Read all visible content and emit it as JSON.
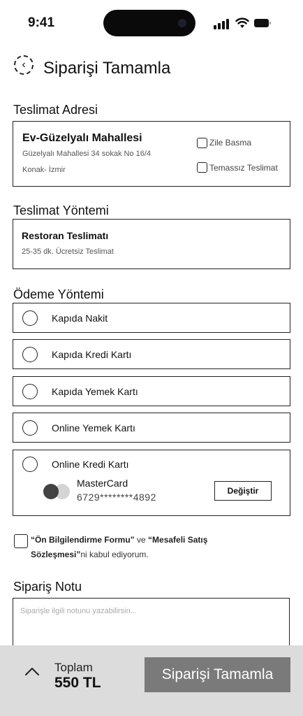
{
  "status_bar": {
    "time": "9:41"
  },
  "header": {
    "title": "Siparişi Tamamla"
  },
  "address": {
    "section_title": "Teslimat Adresi",
    "name": "Ev-Güzelyalı Mahallesi",
    "line1": "Güzelyalı Mahallesi 34 sokak No 16/4",
    "line2": "Konak- İzmir",
    "options": [
      {
        "label": "Zile Basma",
        "checked": false
      },
      {
        "label": "Temassız Teslimat",
        "checked": false
      }
    ]
  },
  "delivery": {
    "section_title": "Teslimat Yöntemi",
    "name": "Restoran Teslimatı",
    "info": "25-35 dk. Ücretsiz Teslimat"
  },
  "payment": {
    "section_title": "Ödeme Yöntemi",
    "methods": [
      {
        "label": "Kapıda Nakit"
      },
      {
        "label": "Kapıda Kredi Kartı"
      },
      {
        "label": "Kapıda Yemek Kartı"
      },
      {
        "label": "Online Yemek Kartı"
      },
      {
        "label": "Online Kredi Kartı"
      }
    ],
    "card": {
      "brand": "MasterCard",
      "number": "6729********4892",
      "change_label": "Değiştir",
      "colors": {
        "left": "#333333",
        "right": "#d4d4d4"
      }
    }
  },
  "agreement": {
    "link1": "“Ön Bilgilendirme Formu”",
    "connector": " ve ",
    "link2": "“Mesafeli Satış Sözleşmesi”",
    "suffix": "ni kabul ediyorum."
  },
  "note": {
    "section_title": "Sipariş Notu",
    "placeholder": "Siparişle ilgili notunu yazabilirsin..."
  },
  "footer": {
    "total_label": "Toplam",
    "total_value": "550 TL",
    "submit_label": "Siparişi Tamamla",
    "icons": {
      "expand": "chevron-up-icon"
    }
  },
  "colors": {
    "text": "#111111",
    "border": "#222222",
    "footer_bg": "#dcdcdc",
    "submit_bg": "#7a7a7a"
  }
}
